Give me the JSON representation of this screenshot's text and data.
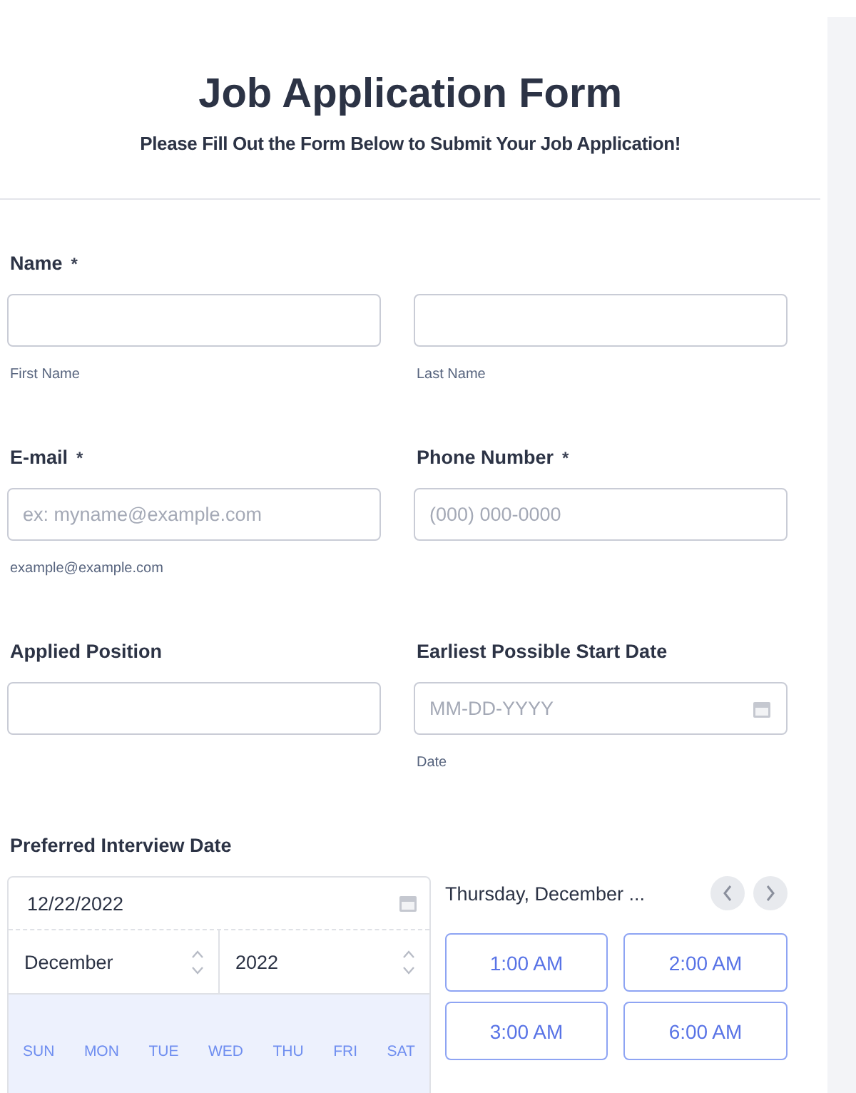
{
  "header": {
    "title": "Job Application Form",
    "subtitle": "Please Fill Out the Form Below to Submit Your Job Application!"
  },
  "rows": [
    {
      "fields": [
        {
          "label": "Name",
          "required_mark": "*",
          "inputs": [
            {
              "kind": "text",
              "sublabel": "First Name"
            },
            {
              "kind": "text",
              "sublabel": "Last Name"
            }
          ]
        }
      ]
    },
    {
      "fields": [
        {
          "label": "E-mail",
          "required_mark": "*",
          "inputs": [
            {
              "kind": "text",
              "placeholder": "ex: myname@example.com",
              "sublabel": "example@example.com"
            }
          ]
        },
        {
          "label": "Phone Number",
          "required_mark": "*",
          "inputs": [
            {
              "kind": "text",
              "placeholder": "(000) 000-0000"
            }
          ]
        }
      ]
    },
    {
      "fields": [
        {
          "label": "Applied Position",
          "inputs": [
            {
              "kind": "text"
            }
          ]
        },
        {
          "label": "Earliest Possible Start Date",
          "inputs": [
            {
              "placeholder": "MM-DD-YYYY",
              "sublabel": "Date",
              "kind": "date"
            }
          ]
        }
      ]
    }
  ],
  "interview": {
    "label": "Preferred Interview Date",
    "date": "12/22/2022",
    "month": "December",
    "year": "2022",
    "weekdays": [
      "SUN",
      "MON",
      "TUE",
      "WED",
      "THU",
      "FRI",
      "SAT"
    ],
    "day_title": "Thursday, December ...",
    "slots": [
      {
        "label": "1:00 AM",
        "selected": false
      },
      {
        "label": "2:00 AM",
        "selected": false
      },
      {
        "label": "3:00 AM",
        "selected": false
      },
      {
        "label": "6:00 AM",
        "selected": false
      }
    ]
  }
}
